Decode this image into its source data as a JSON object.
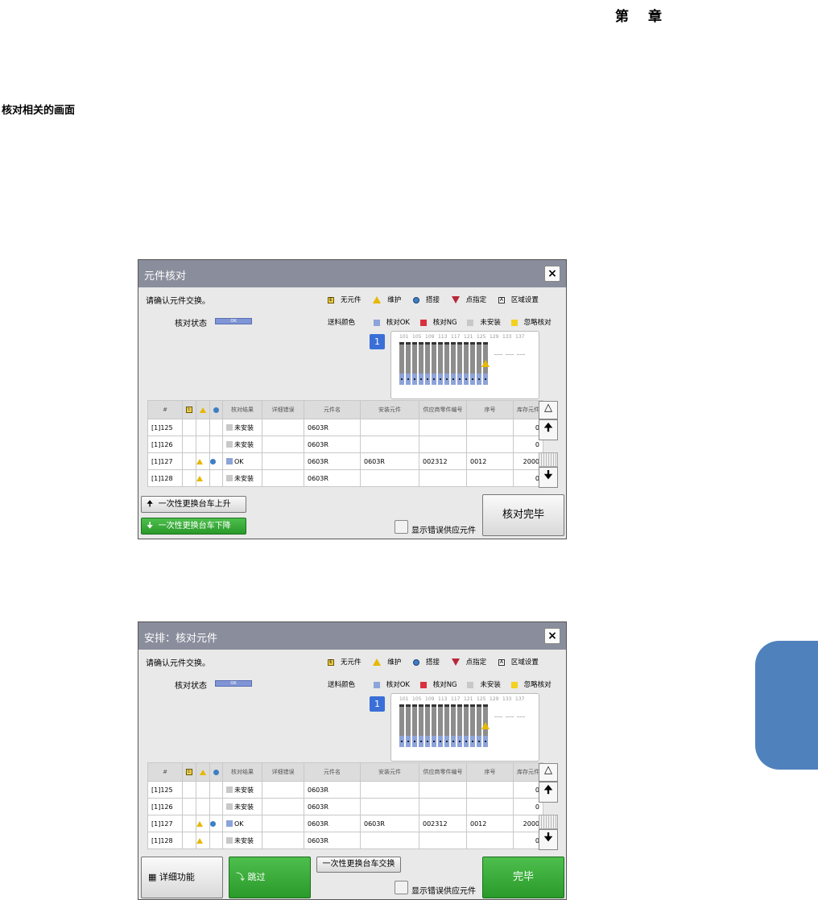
{
  "page": {
    "chapter_label": "第",
    "chapter_label2": "章",
    "section_title": "核对相关的画面"
  },
  "common": {
    "prompt": "请确认元件交换。",
    "verify_status_label": "核对状态",
    "verify_status_value": "OK",
    "legend": {
      "no_component": "无元件",
      "maintenance": "维护",
      "splice": "搭接",
      "point_specified": "点指定",
      "area_setting": "区域设置"
    },
    "feed_colors": {
      "label": "送料颜色",
      "ok": "核对OK",
      "ng": "核对NG",
      "not_mounted": "未安装",
      "ignore": "忽略核对"
    },
    "colors": {
      "ok": "#8da3d9",
      "ng": "#d9303f",
      "not_mounted": "#c8c8c8",
      "ignore": "#f2d21f"
    },
    "feeder": {
      "table_no": "1",
      "slot_numbers": [
        "101",
        "105",
        "109",
        "113",
        "117",
        "121",
        "125",
        "129",
        "133",
        "137"
      ]
    },
    "table": {
      "headers": [
        "#",
        "",
        "",
        "",
        "核对结果",
        "详细错误",
        "元件名",
        "安装元件",
        "供应商零件编号",
        "序号",
        "库存元件"
      ],
      "rows": [
        {
          "no": "[1]125",
          "warn": false,
          "splice": false,
          "result": "未安装",
          "result_color": "not_mounted",
          "detail": "",
          "name": "0603R",
          "mounted": "",
          "vendor": "",
          "serial": "",
          "stock": "0"
        },
        {
          "no": "[1]126",
          "warn": false,
          "splice": false,
          "result": "未安装",
          "result_color": "not_mounted",
          "detail": "",
          "name": "0603R",
          "mounted": "",
          "vendor": "",
          "serial": "",
          "stock": "0"
        },
        {
          "no": "[1]127",
          "warn": true,
          "splice": true,
          "result": "OK",
          "result_color": "ok",
          "detail": "",
          "name": "0603R",
          "mounted": "0603R",
          "vendor": "002312",
          "serial": "0012",
          "stock": "2000"
        },
        {
          "no": "[1]128",
          "warn": true,
          "splice": false,
          "result": "未安装",
          "result_color": "not_mounted",
          "detail": "",
          "name": "0603R",
          "mounted": "",
          "vendor": "",
          "serial": "",
          "stock": "0"
        }
      ]
    },
    "show_error_vendor": "显示错误供应元件"
  },
  "dialog1": {
    "title": "元件核对",
    "cart_up": "一次性更换台车上升",
    "cart_down": "一次性更换台车下降",
    "finish_verify": "核对完毕"
  },
  "dialog2": {
    "title": "安排：核对元件",
    "detail_function": "详细功能",
    "skip": "跳过",
    "cart_exchange": "一次性更换台车交换",
    "finish": "完毕"
  }
}
